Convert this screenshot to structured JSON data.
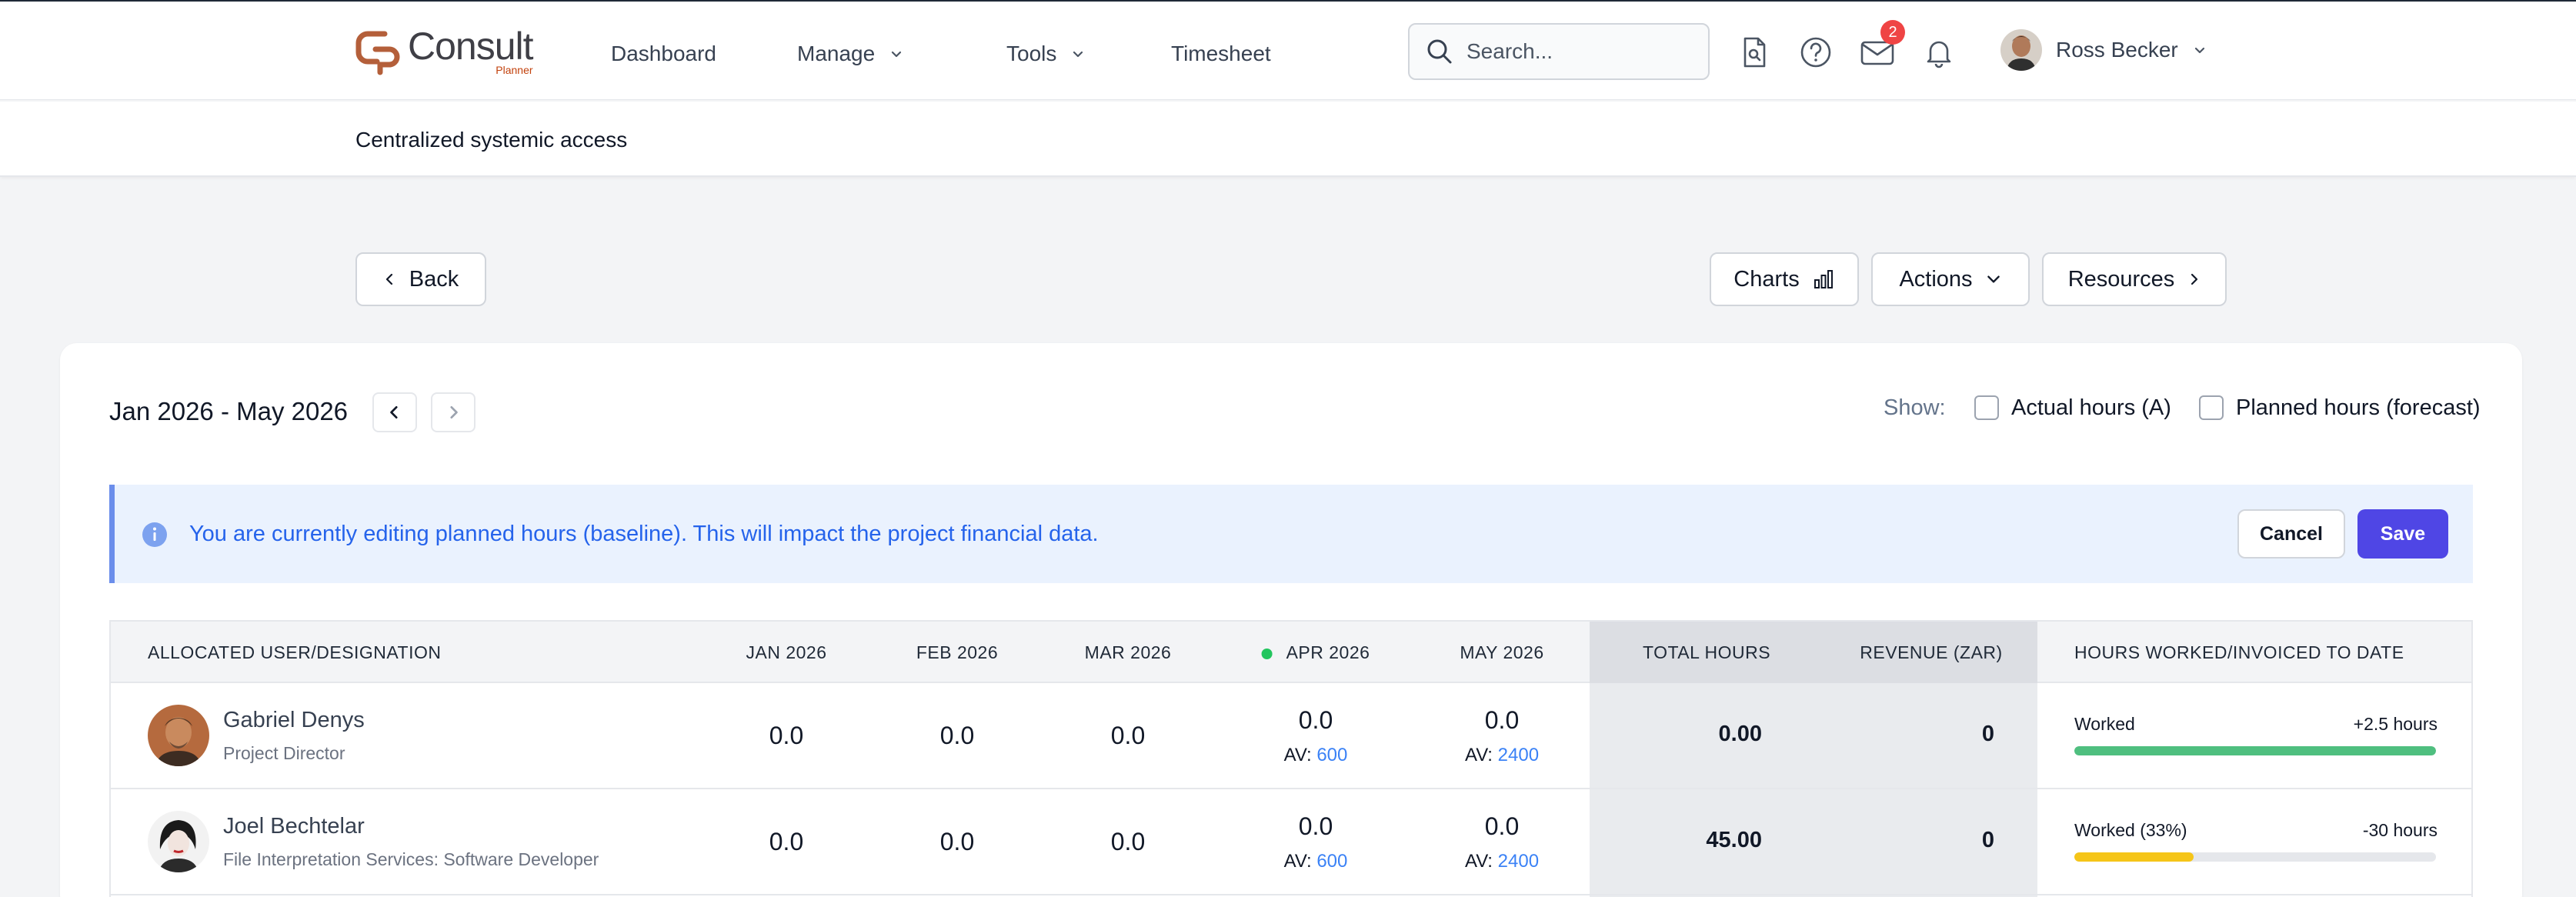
{
  "nav": {
    "logo_text": "Consult",
    "logo_sub": "Planner",
    "items": [
      {
        "label": "Dashboard"
      },
      {
        "label": "Manage"
      },
      {
        "label": "Tools"
      },
      {
        "label": "Timesheet"
      }
    ],
    "search_placeholder": "Search...",
    "mail_count": "2",
    "user_name": "Ross Becker"
  },
  "subheader": {
    "title": "Centralized systemic access"
  },
  "toolbar": {
    "back_label": "Back",
    "charts_label": "Charts",
    "actions_label": "Actions",
    "resources_label": "Resources"
  },
  "period": {
    "range": "Jan 2026 - May 2026",
    "show_label": "Show:",
    "actual_label": "Actual hours (A)",
    "planned_label": "Planned hours (forecast)",
    "actual_checked": false,
    "planned_checked": false
  },
  "alert": {
    "text": "You are currently editing planned hours (baseline). This will impact the project financial data.",
    "cancel_label": "Cancel",
    "save_label": "Save"
  },
  "table": {
    "headers": {
      "user": "ALLOCATED USER/DESIGNATION",
      "jan": "JAN 2026",
      "feb": "FEB 2026",
      "mar": "MAR 2026",
      "apr": "APR 2026",
      "may": "MAY 2026",
      "total": "TOTAL HOURS",
      "revenue": "REVENUE (ZAR)",
      "worked": "HOURS WORKED/INVOICED TO DATE"
    },
    "av_prefix": "AV:",
    "rows": [
      {
        "name": "Gabriel Denys",
        "role": "Project Director",
        "jan": "0.0",
        "feb": "0.0",
        "mar": "0.0",
        "apr": "0.0",
        "apr_av": "600",
        "may": "0.0",
        "may_av": "2400",
        "total": "0.00",
        "revenue": "0",
        "worked_label": "Worked",
        "worked_hours": "+2.5 hours",
        "progress": 1.0,
        "progress_color": "#4fbf7f"
      },
      {
        "name": "Joel Bechtelar",
        "role": "File Interpretation Services: Software Developer",
        "jan": "0.0",
        "feb": "0.0",
        "mar": "0.0",
        "apr": "0.0",
        "apr_av": "600",
        "may": "0.0",
        "may_av": "2400",
        "total": "45.00",
        "revenue": "0",
        "worked_label": "Worked (33%)",
        "worked_hours": "-30 hours",
        "progress": 0.33,
        "progress_color": "#f5c518"
      }
    ]
  },
  "colors": {
    "accent": "#4f46e5",
    "info_bg": "#eaf2fe",
    "info_text": "#2563eb",
    "link": "#3b82f6",
    "current_month_dot": "#22c55e"
  }
}
